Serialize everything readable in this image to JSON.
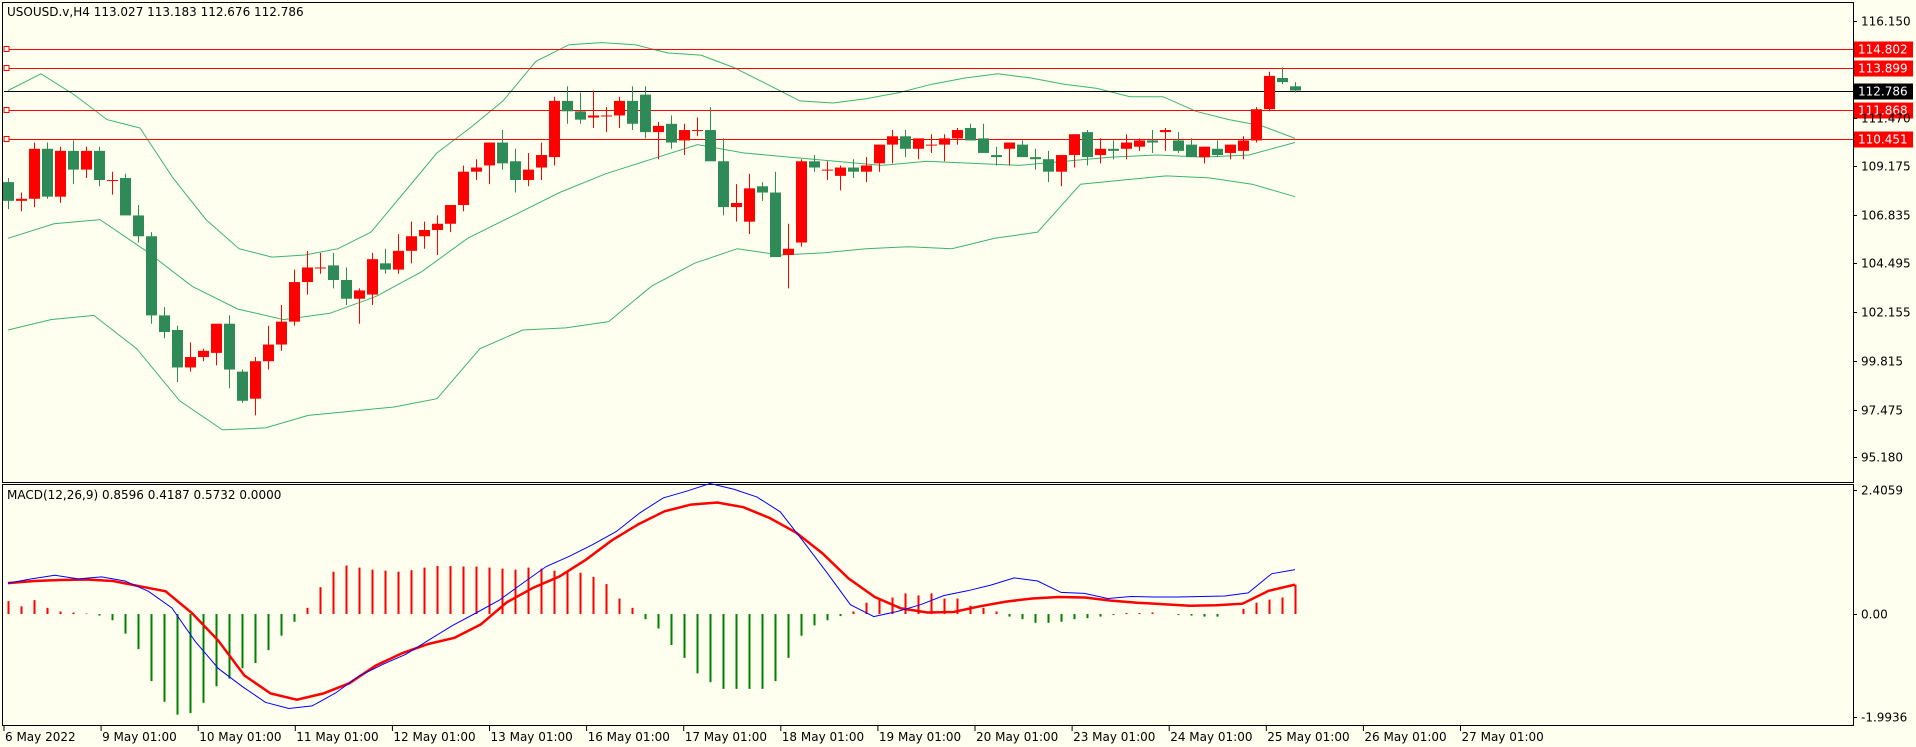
{
  "header": {
    "symbol": "USOUSD.v,H4",
    "ohlc": "113.027 113.183 112.676 112.786",
    "macd_label": "MACD(12,26,9) 0.8596 0.4187 0.5732 0.0000"
  },
  "colors": {
    "background": "#FFFFF0",
    "bull": "#2E8B57",
    "bear": "#FF0000",
    "bands": "#3CB371",
    "level_line": "#FF0000",
    "price_tag": "#000000",
    "macd_line": "#0000FF",
    "signal_line": "#FF0000",
    "hist_up": "#FF0000",
    "hist_down": "#008000"
  },
  "chart_data": [
    {
      "type": "candlestick",
      "panel": "price",
      "ylim": [
        94.0,
        117.0
      ],
      "y_ticks": [
        "116.150",
        "111.470",
        "109.175",
        "106.835",
        "104.495",
        "102.155",
        "99.815",
        "97.475",
        "95.180"
      ],
      "x_tick_labels": [
        "6 May 2022",
        "9 May 01:00",
        "10 May 01:00",
        "11 May 01:00",
        "12 May 01:00",
        "13 May 01:00",
        "16 May 01:00",
        "17 May 01:00",
        "18 May 01:00",
        "19 May 01:00",
        "20 May 01:00",
        "23 May 01:00",
        "24 May 01:00",
        "25 May 01:00",
        "26 May 01:00",
        "27 May 01:00"
      ],
      "levels": [
        114.802,
        113.899,
        111.868,
        110.451
      ],
      "current_price": 112.786,
      "candles": [
        [
          108.4,
          108.6,
          107.1,
          107.5
        ],
        [
          107.5,
          107.9,
          107.0,
          107.6
        ],
        [
          107.6,
          110.3,
          107.2,
          110.0
        ],
        [
          110.0,
          110.3,
          107.6,
          107.7
        ],
        [
          107.7,
          110.1,
          107.4,
          109.9
        ],
        [
          109.9,
          110.4,
          108.3,
          109.0
        ],
        [
          109.0,
          110.1,
          108.6,
          109.9
        ],
        [
          109.9,
          110.1,
          108.2,
          108.5
        ],
        [
          108.5,
          108.9,
          107.8,
          108.5
        ],
        [
          108.6,
          108.8,
          107.5,
          106.8
        ],
        [
          106.8,
          107.3,
          105.5,
          105.8
        ],
        [
          105.8,
          106.0,
          101.6,
          102.0
        ],
        [
          102.0,
          102.4,
          100.9,
          101.2
        ],
        [
          101.3,
          101.5,
          98.8,
          99.5
        ],
        [
          99.5,
          100.7,
          99.3,
          100.0
        ],
        [
          100.0,
          100.4,
          99.8,
          100.3
        ],
        [
          100.2,
          101.5,
          99.6,
          101.6
        ],
        [
          101.6,
          102.0,
          98.5,
          99.4
        ],
        [
          99.3,
          99.4,
          97.8,
          97.9
        ],
        [
          98.0,
          100.0,
          97.2,
          99.8
        ],
        [
          99.8,
          101.5,
          99.4,
          100.6
        ],
        [
          100.6,
          102.5,
          100.3,
          101.7
        ],
        [
          101.7,
          104.2,
          101.5,
          103.6
        ],
        [
          103.6,
          105.1,
          103.0,
          104.3
        ],
        [
          104.3,
          105.0,
          104.0,
          104.3
        ],
        [
          104.4,
          105.0,
          103.3,
          103.7
        ],
        [
          103.7,
          104.3,
          102.5,
          102.8
        ],
        [
          102.8,
          103.3,
          101.6,
          103.2
        ],
        [
          103.0,
          105.0,
          102.5,
          104.7
        ],
        [
          104.5,
          105.2,
          104.0,
          104.2
        ],
        [
          104.2,
          105.9,
          104.0,
          105.1
        ],
        [
          105.1,
          106.5,
          104.5,
          105.8
        ],
        [
          105.8,
          106.5,
          105.2,
          106.1
        ],
        [
          106.1,
          106.8,
          104.9,
          106.4
        ],
        [
          106.4,
          107.2,
          106.0,
          107.3
        ],
        [
          107.3,
          109.2,
          107.0,
          108.9
        ],
        [
          108.9,
          109.5,
          108.5,
          109.1
        ],
        [
          109.2,
          110.3,
          108.3,
          110.3
        ],
        [
          110.3,
          110.9,
          109.0,
          109.3
        ],
        [
          109.4,
          110.0,
          107.9,
          108.5
        ],
        [
          108.5,
          109.8,
          108.2,
          109.0
        ],
        [
          109.1,
          110.3,
          108.5,
          109.7
        ],
        [
          109.6,
          112.5,
          109.2,
          112.3
        ],
        [
          112.3,
          113.0,
          111.2,
          111.8
        ],
        [
          111.8,
          112.7,
          111.2,
          111.4
        ],
        [
          111.5,
          112.8,
          111.0,
          111.6
        ],
        [
          111.6,
          112.0,
          110.8,
          111.6
        ],
        [
          111.6,
          112.5,
          111.0,
          112.3
        ],
        [
          112.3,
          113.0,
          110.9,
          111.2
        ],
        [
          112.6,
          113.0,
          110.5,
          110.8
        ],
        [
          110.8,
          111.3,
          109.5,
          111.1
        ],
        [
          111.2,
          111.6,
          110.0,
          110.3
        ],
        [
          110.4,
          111.2,
          109.7,
          110.9
        ],
        [
          110.9,
          111.5,
          110.6,
          110.9
        ],
        [
          110.9,
          112.0,
          109.5,
          109.4
        ],
        [
          109.4,
          110.5,
          106.8,
          107.2
        ],
        [
          107.2,
          108.3,
          106.5,
          107.4
        ],
        [
          106.5,
          108.8,
          105.9,
          108.1
        ],
        [
          108.2,
          108.4,
          107.5,
          107.9
        ],
        [
          107.9,
          108.9,
          105.0,
          104.8
        ],
        [
          104.9,
          106.4,
          103.3,
          105.2
        ],
        [
          105.5,
          109.5,
          105.3,
          109.4
        ],
        [
          109.4,
          109.7,
          108.9,
          109.1
        ],
        [
          109.0,
          109.4,
          108.5,
          109.0
        ],
        [
          108.7,
          109.2,
          108.0,
          109.1
        ],
        [
          109.1,
          109.5,
          108.6,
          108.9
        ],
        [
          108.9,
          109.6,
          108.4,
          109.2
        ],
        [
          109.3,
          110.2,
          108.9,
          110.2
        ],
        [
          110.2,
          110.9,
          109.3,
          110.6
        ],
        [
          110.6,
          110.9,
          109.6,
          110.0
        ],
        [
          110.0,
          110.4,
          109.5,
          110.5
        ],
        [
          110.2,
          110.7,
          109.8,
          110.2
        ],
        [
          110.2,
          110.7,
          109.4,
          110.5
        ],
        [
          110.5,
          111.0,
          110.2,
          110.9
        ],
        [
          111.0,
          111.2,
          110.6,
          110.4
        ],
        [
          110.5,
          111.2,
          110.0,
          109.8
        ],
        [
          109.7,
          110.1,
          109.2,
          109.6
        ],
        [
          110.0,
          110.3,
          109.2,
          110.3
        ],
        [
          110.2,
          110.4,
          109.8,
          109.6
        ],
        [
          109.6,
          110.0,
          109.0,
          109.5
        ],
        [
          109.5,
          109.9,
          108.4,
          108.9
        ],
        [
          108.9,
          109.6,
          108.2,
          109.7
        ],
        [
          109.7,
          110.6,
          109.1,
          110.7
        ],
        [
          110.8,
          110.9,
          109.2,
          109.6
        ],
        [
          109.7,
          110.5,
          109.3,
          110.0
        ],
        [
          110.0,
          110.4,
          109.5,
          109.9
        ],
        [
          110.0,
          110.7,
          109.5,
          110.3
        ],
        [
          110.1,
          110.5,
          109.9,
          110.4
        ],
        [
          110.4,
          110.9,
          109.8,
          110.3
        ],
        [
          110.8,
          111.0,
          109.9,
          110.9
        ],
        [
          110.4,
          110.8,
          109.8,
          109.9
        ],
        [
          110.2,
          110.5,
          109.6,
          109.6
        ],
        [
          109.6,
          110.1,
          109.3,
          110.1
        ],
        [
          110.0,
          110.4,
          109.6,
          109.7
        ],
        [
          109.8,
          110.2,
          109.5,
          110.2
        ],
        [
          109.9,
          110.6,
          109.5,
          110.4
        ],
        [
          110.4,
          112.0,
          110.3,
          111.9
        ],
        [
          111.9,
          113.7,
          111.8,
          113.5
        ],
        [
          113.4,
          113.9,
          113.1,
          113.2
        ],
        [
          113.0,
          113.2,
          112.7,
          112.8
        ]
      ],
      "bollinger_upper": [
        112.8,
        113.6,
        112.6,
        111.4,
        111.0,
        108.6,
        106.6,
        105.2,
        104.8,
        104.9,
        105.2,
        106.0,
        107.9,
        109.8,
        111.0,
        112.3,
        114.2,
        115.0,
        115.1,
        115.0,
        114.6,
        114.5,
        113.9,
        113.1,
        112.3,
        112.2,
        112.4,
        112.7,
        113.1,
        113.4,
        113.6,
        113.4,
        113.1,
        112.9,
        112.5,
        112.5,
        111.8,
        111.4,
        111.1,
        110.5
      ],
      "bollinger_middle": [
        105.7,
        106.4,
        106.6,
        105.1,
        103.4,
        102.3,
        101.8,
        102.1,
        102.9,
        104.1,
        105.7,
        106.8,
        107.9,
        108.8,
        109.5,
        110.2,
        109.8,
        109.6,
        109.4,
        109.2,
        109.4,
        109.3,
        109.2,
        109.4,
        109.6,
        109.7,
        109.6,
        109.7,
        110.3
      ],
      "bollinger_lower": [
        101.3,
        101.8,
        102.0,
        100.4,
        97.9,
        96.5,
        96.6,
        97.2,
        97.4,
        97.6,
        98.0,
        100.4,
        101.3,
        101.4,
        101.7,
        103.4,
        104.5,
        105.2,
        104.9,
        105.0,
        105.2,
        105.3,
        105.2,
        105.7,
        106.0,
        108.3,
        108.5,
        108.7,
        108.6,
        108.3,
        107.7
      ]
    },
    {
      "type": "macd",
      "panel": "indicator",
      "ylim": [
        -2.15,
        2.5
      ],
      "y_ticks": [
        "2.4059",
        "0.00",
        "-1.9936"
      ],
      "histogram": [
        0.25,
        0.15,
        0.27,
        0.12,
        0.05,
        0.03,
        0.01,
        -0.03,
        -0.12,
        -0.38,
        -0.68,
        -1.3,
        -1.7,
        -1.95,
        -1.92,
        -1.72,
        -1.4,
        -1.25,
        -1.05,
        -0.95,
        -0.7,
        -0.42,
        -0.15,
        0.12,
        0.52,
        0.82,
        0.94,
        0.9,
        0.86,
        0.84,
        0.82,
        0.85,
        0.9,
        0.93,
        0.93,
        0.92,
        0.92,
        0.9,
        0.88,
        0.86,
        0.9,
        0.88,
        0.84,
        0.82,
        0.8,
        0.72,
        0.58,
        0.3,
        0.12,
        -0.1,
        -0.28,
        -0.6,
        -0.85,
        -1.15,
        -1.32,
        -1.45,
        -1.45,
        -1.45,
        -1.45,
        -1.3,
        -0.85,
        -0.42,
        -0.22,
        -0.12,
        -0.04,
        0.05,
        0.22,
        0.3,
        0.32,
        0.4,
        0.36,
        0.4,
        0.3,
        0.3,
        0.16,
        0.12,
        0.05,
        -0.05,
        -0.1,
        -0.17,
        -0.17,
        -0.15,
        -0.1,
        -0.08,
        -0.05,
        -0.02,
        0.02,
        0.02,
        0.03,
        0.0,
        -0.02,
        -0.03,
        -0.05,
        -0.05,
        0.0,
        0.1,
        0.22,
        0.28,
        0.32,
        0.57
      ],
      "macd_line": [
        0.6,
        0.68,
        0.75,
        0.68,
        0.72,
        0.64,
        0.44,
        0.12,
        -0.53,
        -1.06,
        -1.4,
        -1.71,
        -1.83,
        -1.78,
        -1.53,
        -1.2,
        -0.98,
        -0.78,
        -0.5,
        -0.22,
        0.02,
        0.27,
        0.6,
        0.92,
        1.12,
        1.35,
        1.6,
        1.96,
        2.25,
        2.38,
        2.53,
        2.42,
        2.27,
        1.98,
        1.4,
        0.8,
        0.18,
        -0.05,
        0.05,
        0.18,
        0.36,
        0.45,
        0.56,
        0.7,
        0.64,
        0.42,
        0.4,
        0.3,
        0.34,
        0.33,
        0.33,
        0.34,
        0.35,
        0.41,
        0.78,
        0.86
      ],
      "signal_line": [
        0.6,
        0.64,
        0.66,
        0.67,
        0.64,
        0.54,
        0.44,
        0.02,
        -0.51,
        -1.19,
        -1.54,
        -1.66,
        -1.54,
        -1.34,
        -1.0,
        -0.76,
        -0.58,
        -0.46,
        -0.2,
        0.23,
        0.51,
        0.73,
        1.05,
        1.43,
        1.74,
        1.99,
        2.12,
        2.16,
        2.07,
        1.86,
        1.58,
        1.18,
        0.69,
        0.33,
        0.11,
        0.03,
        0.04,
        0.15,
        0.24,
        0.3,
        0.33,
        0.32,
        0.26,
        0.22,
        0.19,
        0.16,
        0.17,
        0.2,
        0.45,
        0.57
      ]
    }
  ]
}
